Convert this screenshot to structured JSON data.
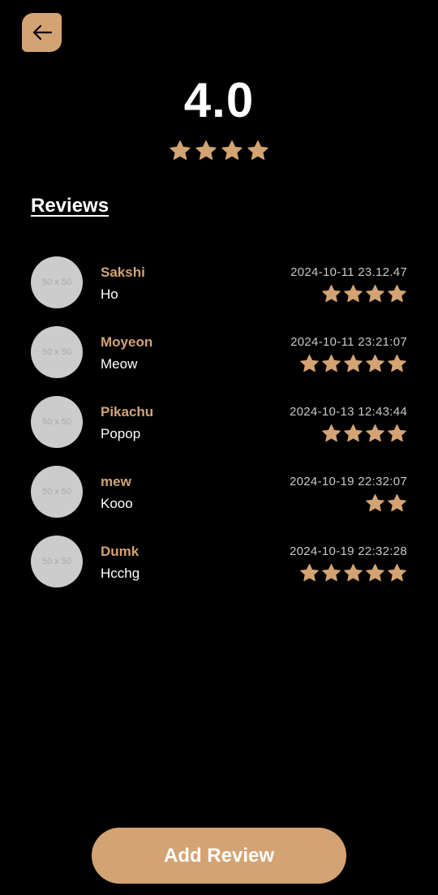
{
  "header": {
    "back_icon": "arrow-left-icon"
  },
  "summary": {
    "rating": "4.0",
    "stars": 4
  },
  "reviews_section": {
    "title": "Reviews"
  },
  "reviews": [
    {
      "name": "Sakshi",
      "text": "Ho",
      "date": "2024-10-11 23.12.47",
      "stars": 4,
      "avatar_placeholder": "50 x 50"
    },
    {
      "name": "Moyeon",
      "text": "Meow",
      "date": "2024-10-11 23:21:07",
      "stars": 5,
      "avatar_placeholder": "50 x 50"
    },
    {
      "name": "Pikachu",
      "text": "Popop",
      "date": "2024-10-13 12:43:44",
      "stars": 4,
      "avatar_placeholder": "50 x 50"
    },
    {
      "name": "mew",
      "text": "Kooo",
      "date": "2024-10-19 22:32:07",
      "stars": 2,
      "avatar_placeholder": "50 x 50"
    },
    {
      "name": "Dumk",
      "text": "Hcchg",
      "date": "2024-10-19 22:32:28",
      "stars": 5,
      "avatar_placeholder": "50 x 50"
    }
  ],
  "actions": {
    "add_review_label": "Add Review"
  },
  "colors": {
    "accent": "#d4a373",
    "background": "#000000",
    "avatar_placeholder": "#cccccc"
  }
}
